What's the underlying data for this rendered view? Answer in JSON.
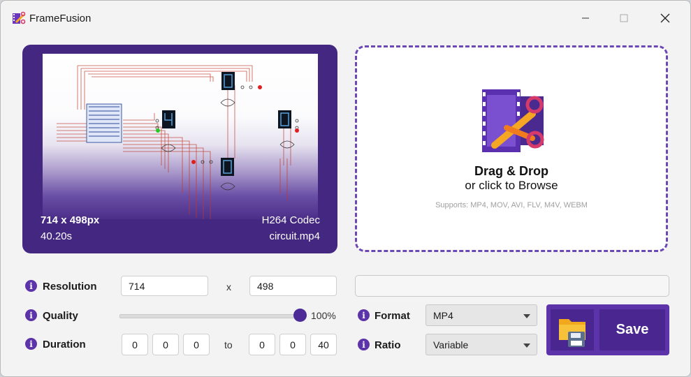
{
  "window": {
    "title": "FrameFusion"
  },
  "preview": {
    "dimensions": "714 x 498px",
    "duration": "40.20s",
    "codec": "H264 Codec",
    "filename": "circuit.mp4"
  },
  "dropzone": {
    "title": "Drag & Drop",
    "subtitle": "or click to Browse",
    "supports": "Supports: MP4, MOV, AVI, FLV, M4V, WEBM"
  },
  "settings": {
    "resolution": {
      "label": "Resolution",
      "width": "714",
      "height": "498",
      "separator": "x"
    },
    "quality": {
      "label": "Quality",
      "value": 100,
      "display": "100%"
    },
    "duration": {
      "label": "Duration",
      "start": [
        "0",
        "0",
        "0"
      ],
      "to_label": "to",
      "end": [
        "0",
        "0",
        "40"
      ]
    },
    "format": {
      "label": "Format",
      "selected": "MP4"
    },
    "ratio": {
      "label": "Ratio",
      "selected": "Variable"
    }
  },
  "progress": {
    "value": 0
  },
  "save": {
    "label": "Save"
  },
  "colors": {
    "accent": "#5c33a8",
    "preview_bg": "#432781",
    "dropzone_border": "#6c48b5",
    "info_icon": "#5c33a8"
  },
  "icons": {
    "app": "film-scissors-icon",
    "dropzone": "film-scissors-icon",
    "save": "folder-floppy-icon",
    "info": "info-icon"
  }
}
